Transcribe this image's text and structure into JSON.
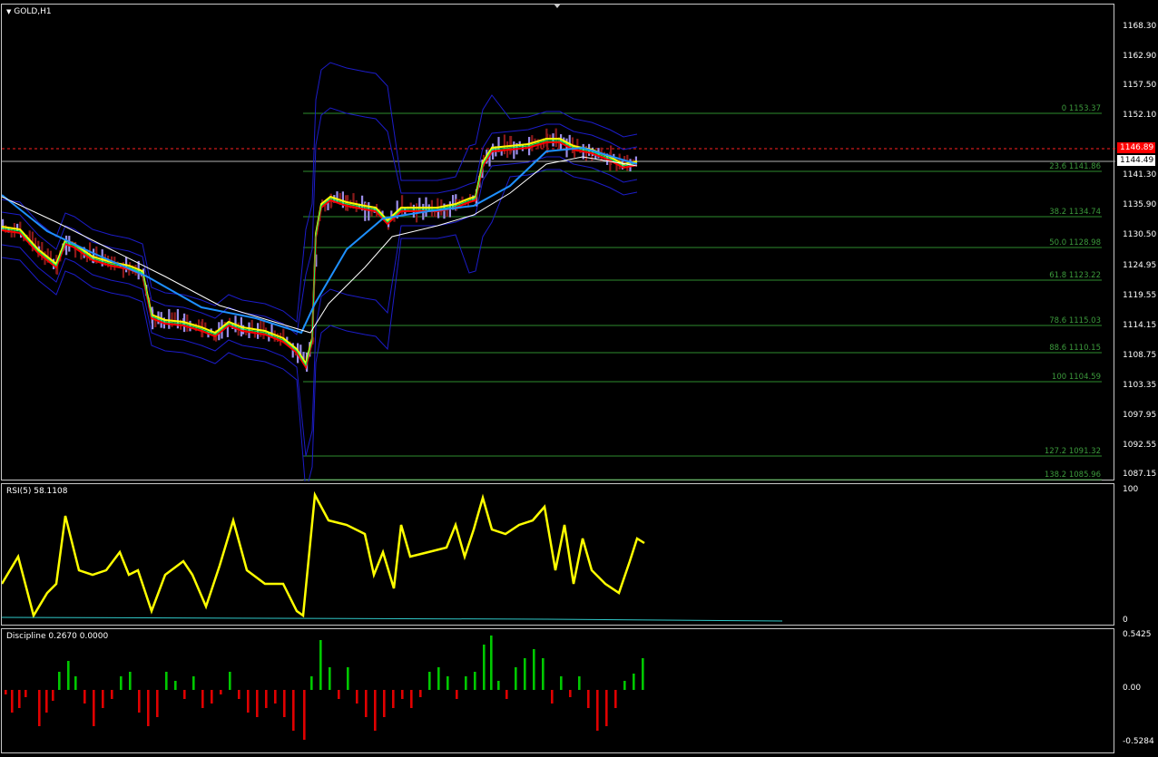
{
  "chart": {
    "title": "GOLD,H1",
    "symbol_menu_icon": "triangle-down-icon"
  },
  "price_axis": [
    "1168.30",
    "1162.90",
    "1157.50",
    "1152.10",
    "1141.30",
    "1135.90",
    "1130.50",
    "1124.95",
    "1119.55",
    "1114.15",
    "1108.75",
    "1103.35",
    "1097.95",
    "1092.55",
    "1087.15"
  ],
  "price_tags": {
    "bid": {
      "label": "1146.89",
      "color": "#ff0000"
    },
    "ask": {
      "label": "1144.49",
      "color": "#ffffff"
    }
  },
  "fibonacci": [
    {
      "label": "0 1153.37"
    },
    {
      "label": "23.6 1141.86"
    },
    {
      "label": "38.2 1134.74"
    },
    {
      "label": "50.0 1128.98"
    },
    {
      "label": "61.8 1123.22"
    },
    {
      "label": "78.6 1115.03"
    },
    {
      "label": "88.6 1110.15"
    },
    {
      "label": "100 1104.59"
    },
    {
      "label": "127.2 1091.32"
    },
    {
      "label": "138.2 1085.96"
    }
  ],
  "rsi": {
    "title": "RSI(5) 58.1108",
    "axis": [
      "100",
      "0"
    ],
    "line_color": "#ffff00"
  },
  "discipline": {
    "title": "Discipline 0.2670 0.0000",
    "axis": [
      "0.5425",
      "0.00",
      "-0.5284"
    ],
    "up_color": "#00c800",
    "down_color": "#e00000"
  },
  "colors": {
    "background": "#000000",
    "grid_border": "#c8c8c8",
    "bands": "#1c1cc8",
    "fib": "#2e8b2e",
    "bull_bar": "#9b8de8",
    "bear_bar": "#8b1a1a"
  }
}
